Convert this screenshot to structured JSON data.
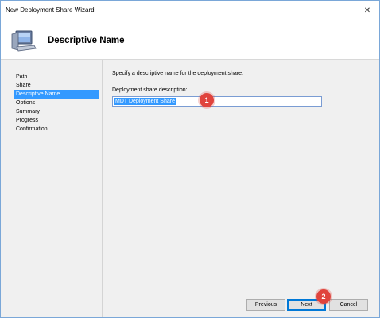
{
  "window": {
    "title": "New Deployment Share Wizard"
  },
  "header": {
    "title": "Descriptive Name",
    "icon": "computer-icon"
  },
  "nav": {
    "items": [
      {
        "label": "Path",
        "active": false
      },
      {
        "label": "Share",
        "active": false
      },
      {
        "label": "Descriptive Name",
        "active": true
      },
      {
        "label": "Options",
        "active": false
      },
      {
        "label": "Summary",
        "active": false
      },
      {
        "label": "Progress",
        "active": false
      },
      {
        "label": "Confirmation",
        "active": false
      }
    ]
  },
  "content": {
    "description": "Specify a descriptive name for the deployment share.",
    "field_label": "Deployment share description:",
    "field_value": "MDT Deployment Share"
  },
  "footer": {
    "previous_label": "Previous",
    "next_label": "Next",
    "cancel_label": "Cancel"
  },
  "annotations": {
    "badge1": "1",
    "badge2": "2"
  },
  "colors": {
    "selection": "#3399ff",
    "badge": "#e0433c",
    "focus_border": "#0078d7"
  }
}
